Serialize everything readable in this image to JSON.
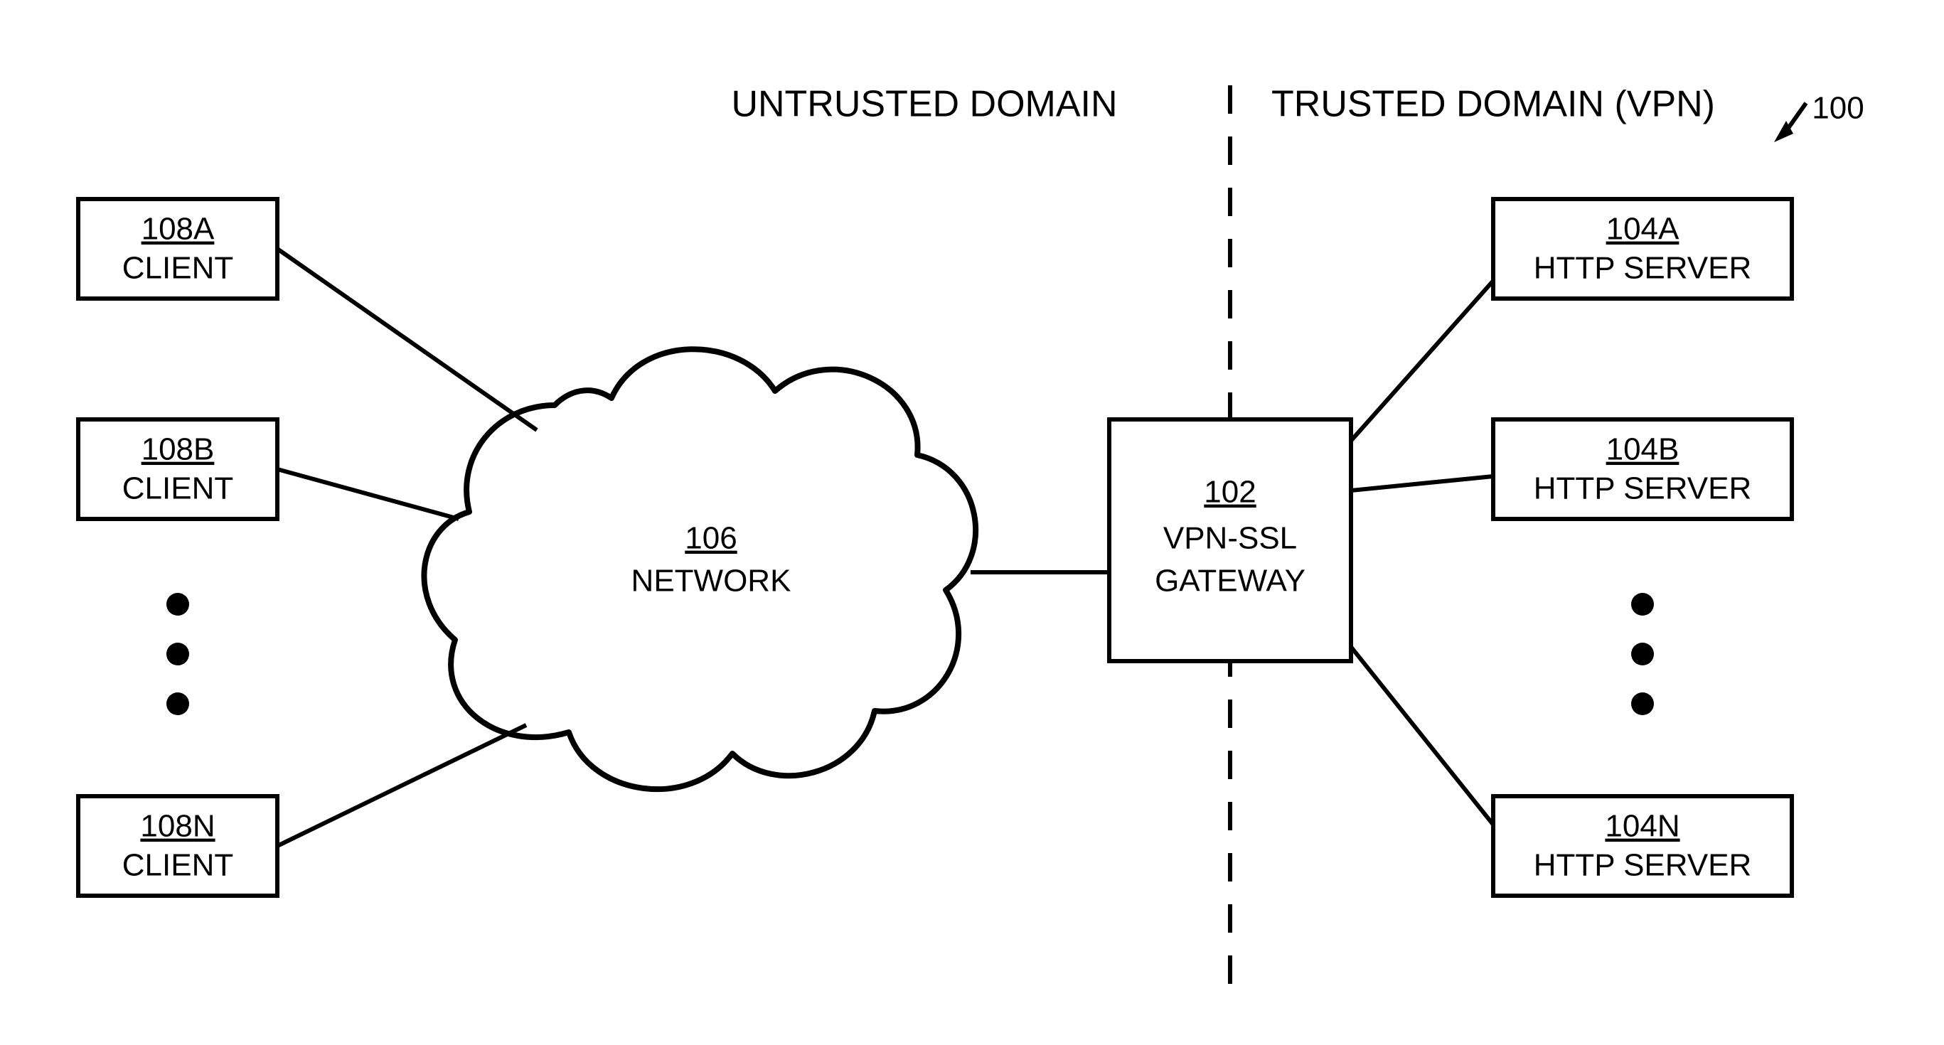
{
  "figure_ref": {
    "id": "100"
  },
  "headers": {
    "untrusted": "UNTRUSTED DOMAIN",
    "trusted": "TRUSTED DOMAIN (VPN)"
  },
  "clients": [
    {
      "id": "108A",
      "label": "CLIENT"
    },
    {
      "id": "108B",
      "label": "CLIENT"
    },
    {
      "id": "108N",
      "label": "CLIENT"
    }
  ],
  "network": {
    "id": "106",
    "label": "NETWORK"
  },
  "gateway": {
    "id": "102",
    "label1": "VPN-SSL",
    "label2": "GATEWAY"
  },
  "servers": [
    {
      "id": "104A",
      "label": "HTTP SERVER"
    },
    {
      "id": "104B",
      "label": "HTTP SERVER"
    },
    {
      "id": "104N",
      "label": "HTTP SERVER"
    }
  ]
}
